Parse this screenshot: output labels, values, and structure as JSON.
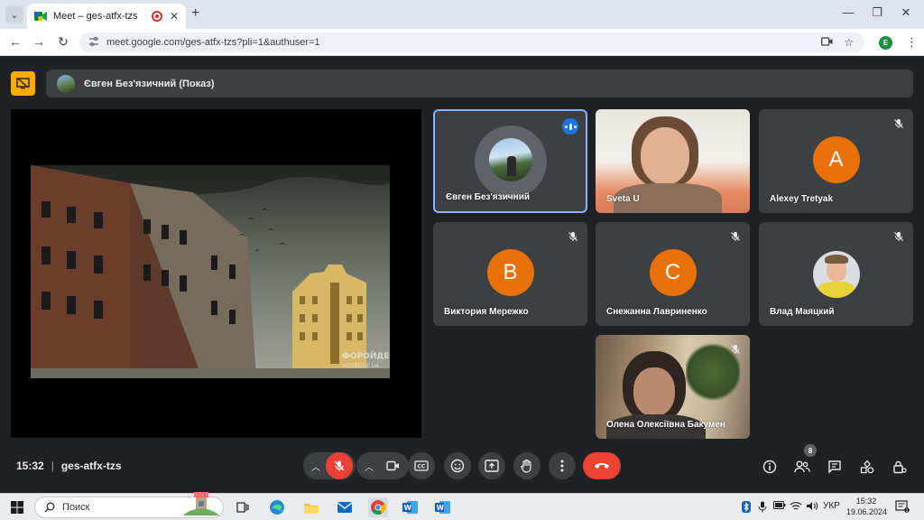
{
  "browser": {
    "tab_title": "Meet – ges-atfx-tzs",
    "url": "meet.google.com/ges-atfx-tzs?pli=1&authuser=1",
    "profile_initial": "E",
    "tab_list_icon": "chevron-down-icon",
    "close_glyph": "✕",
    "new_tab_glyph": "+",
    "minimize_glyph": "—",
    "restore_glyph": "❐",
    "window_close_glyph": "✕",
    "back_glyph": "←",
    "forward_glyph": "→",
    "reload_glyph": "↻"
  },
  "meet": {
    "presenter_label": "Євген Без'язичний (Показ)",
    "meeting_time": "15:32",
    "meeting_code": "ges-atfx-tzs",
    "participant_count": "8",
    "participants": [
      {
        "name": "Євген Без'язичний",
        "type": "photo",
        "speaking": true
      },
      {
        "name": "Sveta U",
        "type": "video"
      },
      {
        "name": "Alexey Tretyak",
        "type": "letter",
        "initial": "A",
        "muted": true
      },
      {
        "name": "Виктория Мережко",
        "type": "letter",
        "initial": "В",
        "muted": true
      },
      {
        "name": "Снежанна Лавриненко",
        "type": "letter",
        "initial": "С",
        "muted": true
      },
      {
        "name": "Влад Маяцкий",
        "type": "photo",
        "muted": true
      },
      {
        "name": "Олена Олексіївна Бакумен",
        "type": "video",
        "muted": true
      }
    ],
    "watermark": "ФОРОЙДЕ",
    "watermark_sub": "VGOROGE.UA"
  },
  "colors": {
    "accent": "#8ab4f8",
    "avatar_orange": "#e8710a",
    "end_call": "#ea4335",
    "mic_off": "#ea4335",
    "present_yellow": "#f9ab00"
  },
  "taskbar": {
    "search_placeholder": "Поиск",
    "language": "УКР",
    "time": "15:32",
    "date": "19.06.2024"
  }
}
